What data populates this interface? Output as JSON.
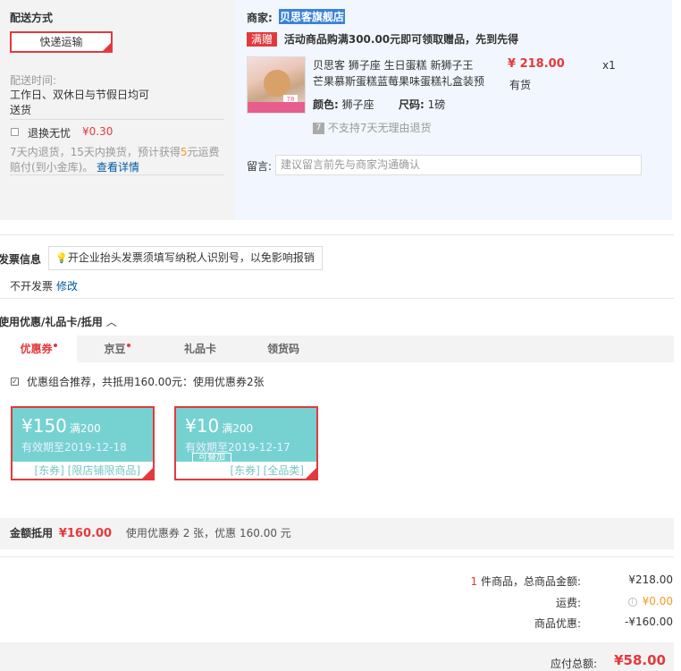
{
  "shipping": {
    "title": "配送方式",
    "method_button": "快递运输",
    "time_label": "配送时间:",
    "time_value_1": "工作日、双休日与节假日均可",
    "time_value_2": "送货",
    "worry_free_label": "退换无忧",
    "worry_free_price": "¥0.30",
    "worry_desc_1a": "7天内退货，15天内换货，预计获得",
    "worry_desc_num": "5",
    "worry_desc_1b": "元运费",
    "worry_desc_2": "赔付(到小金库)。",
    "details_link": "查看详情"
  },
  "store": {
    "label": "商家:",
    "name": "贝思客旗舰店",
    "gift_badge": "满赠",
    "gift_text": "活动商品购满300.00元即可领取赠品，先到先得"
  },
  "product": {
    "title_1": "贝思客 狮子座 生日蛋糕 新狮子王",
    "title_2": "芒果慕斯蛋糕蓝莓果味蛋糕礼盒装预",
    "price": "¥ 218.00",
    "qty": "x1",
    "stock": "有货",
    "color_label": "颜色:",
    "color_value": "狮子座",
    "size_label": "尺码:",
    "size_value": "1磅",
    "return_policy": "不支持7天无理由退货",
    "return_icon": "seven-day-icon",
    "image_tag": "78"
  },
  "note": {
    "label": "留言:",
    "placeholder": "建议留言前先与商家沟通确认"
  },
  "invoice": {
    "title": "发票信息",
    "tip": "开企业抬头发票须填写纳税人识别号，以免影响报销",
    "status": "不开发票",
    "modify": "修改"
  },
  "discounts": {
    "title": "使用优惠/礼品卡/抵用",
    "toggle_icon": "chevron-up-icon",
    "tabs": [
      {
        "label": "优惠券"
      },
      {
        "label": "京豆"
      },
      {
        "label": "礼品卡"
      },
      {
        "label": "领货码"
      }
    ],
    "recommend_text": "优惠组合推荐，共抵用160.00元：使用优惠券2张",
    "coupons": [
      {
        "amount": "¥150",
        "condition": "满200",
        "expiry": "有效期至2019-12-18",
        "categories": "[东券] [限店铺限商品]"
      },
      {
        "amount": "¥10",
        "condition": "满200",
        "expiry": "有效期至2019-12-17",
        "categories": "[东券] [全品类]",
        "badge": "可叠加"
      }
    ],
    "summary_label": "金额抵用",
    "summary_amount": "¥160.00",
    "summary_desc": "使用优惠券 2 张，优惠 160.00 元"
  },
  "totals": {
    "item_count": "1",
    "item_count_label": "件商品，总商品金额:",
    "goods_total": "¥218.00",
    "shipping_label": "运费:",
    "shipping_value": "¥0.00",
    "discount_label": "商品优惠:",
    "discount_value": "-¥160.00",
    "payable_label": "应付总额:",
    "payable_value": "¥58.00"
  }
}
